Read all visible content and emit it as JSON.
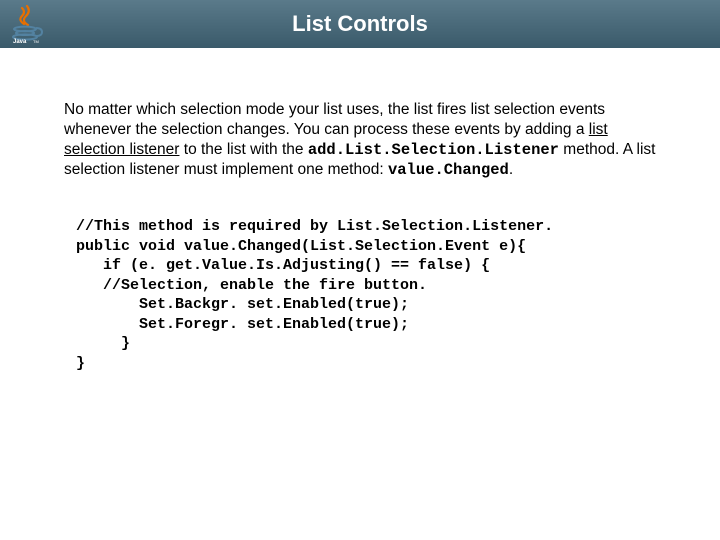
{
  "header": {
    "title": "List Controls",
    "logo_alt": "Java"
  },
  "body": {
    "para_part1": "No matter which selection mode your list uses, the list fires list selection events whenever the selection changes. You can process these events by adding a ",
    "listener_link_text": "list selection listener",
    "para_part2": " to the list with the ",
    "method1": "add.List.Selection.Listener",
    "para_part3": " method. A list selection listener must implement one method: ",
    "method2": "value.Changed",
    "para_part4": "."
  },
  "code": "//This method is required by List.Selection.Listener.\npublic void value.Changed(List.Selection.Event e){\n   if (e. get.Value.Is.Adjusting() == false) {\n   //Selection, enable the fire button.\n       Set.Backgr. set.Enabled(true);\n       Set.Foregr. set.Enabled(true);\n     }\n}"
}
